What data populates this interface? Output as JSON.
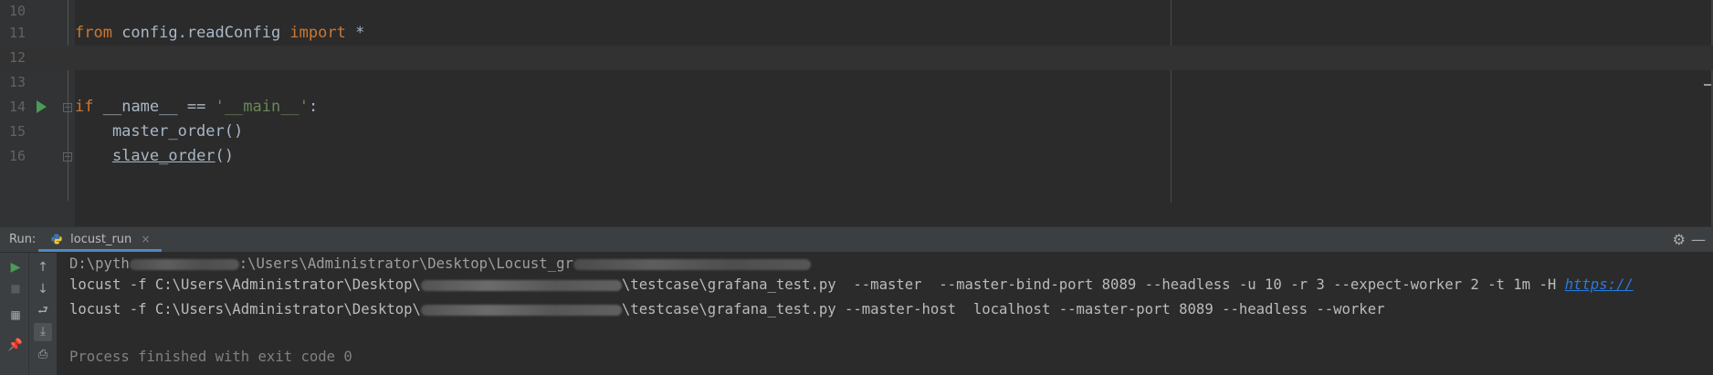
{
  "editor": {
    "lines": [
      {
        "num": "10",
        "tokens": []
      },
      {
        "num": "11",
        "tokens": [
          {
            "t": "from",
            "c": "kw"
          },
          {
            "t": " config.readConfig ",
            "c": ""
          },
          {
            "t": "import",
            "c": "kw"
          },
          {
            "t": " *",
            "c": ""
          }
        ]
      },
      {
        "num": "12",
        "tokens": [],
        "current": true
      },
      {
        "num": "13",
        "tokens": []
      },
      {
        "num": "14",
        "tokens": [
          {
            "t": "if",
            "c": "kw"
          },
          {
            "t": " ",
            "c": ""
          },
          {
            "t": "__name__",
            "c": ""
          },
          {
            "t": " == ",
            "c": ""
          },
          {
            "t": "'__main__'",
            "c": "str"
          },
          {
            "t": ":",
            "c": ""
          }
        ]
      },
      {
        "num": "15",
        "tokens": [
          {
            "t": "    master_order()",
            "c": ""
          }
        ]
      },
      {
        "num": "16",
        "tokens": [
          {
            "t": "    ",
            "c": ""
          },
          {
            "t": "slave_order",
            "c": "underlined"
          },
          {
            "t": "()",
            "c": ""
          }
        ]
      }
    ]
  },
  "run_panel": {
    "title": "Run:",
    "tab_label": "locust_run",
    "tab_close": "×",
    "gear_icon": "gear-icon",
    "minimize_icon": "minimize-icon",
    "console": {
      "line1_prefix": "D:\\pyth",
      "line1_mid": ":\\Users\\Administrator\\Desktop\\Locust_gr",
      "line2_a": "locust -f C:\\Users\\Administrator\\Desktop\\",
      "line2_b": "\\testcase\\grafana_test.py  --master  --master-bind-port 8089 --headless -u 10 -r 3 --expect-worker 2 -t 1m -H ",
      "line2_link": "https://",
      "line3_a": "locust -f C:\\Users\\Administrator\\Desktop\\",
      "line3_b": "\\testcase\\grafana_test.py --master-host  localhost --master-port 8089 --headless --worker",
      "line5": "Process finished with exit code 0"
    }
  },
  "colors": {
    "background": "#2b2b2b",
    "keyword": "#cc7832",
    "string": "#6a8759",
    "run_green": "#499c54",
    "link": "#287bde"
  }
}
